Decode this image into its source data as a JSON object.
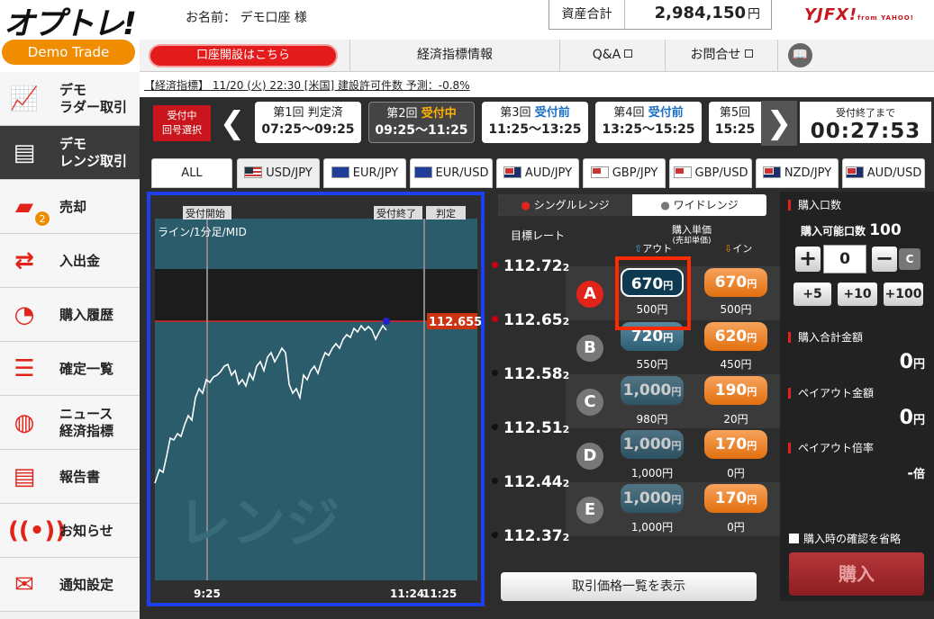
{
  "header": {
    "logo_text": "オプトレ!",
    "demo_badge": "Demo Trade",
    "name_label": "お名前：",
    "name_value": "デモ口座 様",
    "asset_label": "資産合計",
    "asset_value": "2,984,150",
    "asset_unit": "円",
    "brand": "YJFX!",
    "brand_sub": "from YAHOO!"
  },
  "topnav": {
    "open_account": "口座開設はこちら",
    "indicators": "経済指標情報",
    "qa": "Q&A",
    "contact": "お問合せ"
  },
  "ticker": "【経済指標】 11/20 (火) 22:30 [米国] 建設許可件数 予測：-0.8%",
  "sidebar": {
    "items": [
      {
        "label1": "デモ",
        "label2": "ラダー取引",
        "icon": "ladder-chart-icon"
      },
      {
        "label1": "デモ",
        "label2": "レンジ取引",
        "icon": "range-chart-icon"
      },
      {
        "label1": "売却",
        "label2": "",
        "icon": "sell-tickets-icon",
        "badge": "2"
      },
      {
        "label1": "入出金",
        "label2": "",
        "icon": "transfer-arrows-icon"
      },
      {
        "label1": "購入履歴",
        "label2": "",
        "icon": "history-icon"
      },
      {
        "label1": "確定一覧",
        "label2": "",
        "icon": "list-icon"
      },
      {
        "label1": "ニュース",
        "label2": "経済指標",
        "icon": "globe-icon"
      },
      {
        "label1": "報告書",
        "label2": "",
        "icon": "document-icon"
      },
      {
        "label1": "お知らせ",
        "label2": "",
        "icon": "broadcast-icon"
      },
      {
        "label1": "通知設定",
        "label2": "",
        "icon": "mail-icon"
      }
    ]
  },
  "rounds": {
    "label": "受付中\n回号選択",
    "items": [
      {
        "name": "第1回",
        "status": "判定済",
        "time": "07:25〜09:25"
      },
      {
        "name": "第2回",
        "status": "受付中",
        "time": "09:25〜11:25"
      },
      {
        "name": "第3回",
        "status": "受付前",
        "time": "11:25〜13:25"
      },
      {
        "name": "第4回",
        "status": "受付前",
        "time": "13:25〜15:25"
      },
      {
        "name": "第5回",
        "status": "",
        "time": "15:25"
      }
    ],
    "countdown_label": "受付終了まで",
    "countdown": "00:27:53"
  },
  "currency_tabs": [
    "ALL",
    "USD/JPY",
    "EUR/JPY",
    "EUR/USD",
    "AUD/JPY",
    "GBP/JPY",
    "GBP/USD",
    "NZD/JPY",
    "AUD/USD"
  ],
  "chart": {
    "tag_start": "受付開始",
    "tag_end": "受付終了",
    "tag_judge": "判定",
    "title": "ライン/1分足/MID",
    "current_price": "112.655",
    "watermark": "レンジ",
    "x_start": "9:25",
    "x_end1": "11:24",
    "x_end2": "11:25"
  },
  "range": {
    "single": "シングルレンジ",
    "wide": "ワイドレンジ",
    "target_label": "目標レート",
    "unit_label": "購入単価",
    "unit_sub": "(売却単価)",
    "out_label": "アウト",
    "in_label": "イン",
    "rates": [
      "112.72",
      "112.65",
      "112.58",
      "112.51",
      "112.44",
      "112.37"
    ],
    "rate_sub": "2",
    "rows": [
      {
        "letter": "A",
        "out": "670",
        "out_pay": "500円",
        "in": "670",
        "in_pay": "500円"
      },
      {
        "letter": "B",
        "out": "720",
        "out_pay": "550円",
        "in": "620",
        "in_pay": "450円"
      },
      {
        "letter": "C",
        "out": "1,000",
        "out_pay": "980円",
        "in": "190",
        "in_pay": "20円"
      },
      {
        "letter": "D",
        "out": "1,000",
        "out_pay": "1,000円",
        "in": "170",
        "in_pay": "0円"
      },
      {
        "letter": "E",
        "out": "1,000",
        "out_pay": "1,000円",
        "in": "170",
        "in_pay": "0円"
      }
    ],
    "yen": "円",
    "price_list_button": "取引価格一覧を表示"
  },
  "order": {
    "qty_header": "購入口数",
    "available_label": "購入可能口数",
    "available_value": "100",
    "qty_value": "0",
    "plus": "+",
    "minus": "−",
    "clear": "C",
    "add5": "+5",
    "add10": "+10",
    "add100": "+100",
    "total_header": "購入合計金額",
    "total_value": "0",
    "payout_header": "ペイアウト金額",
    "payout_value": "0",
    "ratio_header": "ペイアウト倍率",
    "ratio_value": "-",
    "ratio_unit": "倍",
    "skip_confirm": "購入時の確認を省略",
    "buy": "購入",
    "yen": "円"
  },
  "colors": {
    "accent_red": "#e2231a",
    "demo_orange": "#f08c00",
    "highlight_blue": "#1e3ff0",
    "highlight_red": "#ff2a00"
  }
}
